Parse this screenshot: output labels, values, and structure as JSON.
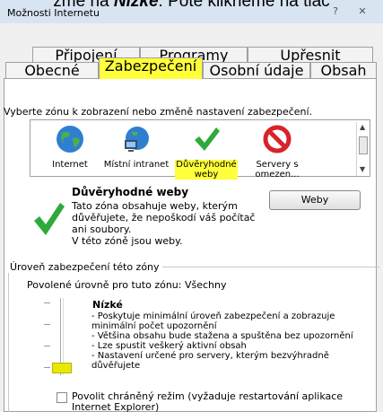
{
  "caption_parts": {
    "pre": "zme na ",
    "bold": "Nízké",
    "post": ". Poté klikneme na tlač"
  },
  "window": {
    "title": "Možnosti Internetu",
    "help_glyph": "?",
    "close_glyph": "✕"
  },
  "tabs_top": [
    "Připojení",
    "Programy",
    "Upřesnit"
  ],
  "tabs_bottom": [
    "Obecné",
    "Zabezpečení",
    "Osobní údaje",
    "Obsah"
  ],
  "zones": {
    "instruction": "Vyberte zónu k zobrazení nebo změně nastavení zabezpečení.",
    "items": [
      {
        "label": "Internet",
        "icon": "globe-icon"
      },
      {
        "label": "Místní intranet",
        "icon": "intranet-icon"
      },
      {
        "label": "Důvěryhodné weby",
        "icon": "checkmark-icon"
      },
      {
        "label": "Servery s omezen...",
        "icon": "restricted-icon"
      }
    ]
  },
  "selected_zone": {
    "name": "Důvěryhodné weby",
    "description_1": "Tato zóna obsahuje weby, kterým důvěřujete, že nepoškodí váš počítač ani soubory.",
    "description_2": "V této zóně jsou weby.",
    "sites_button": "Weby"
  },
  "security_level": {
    "legend": "Úroveň zabezpečení této zóny",
    "allowed": "Povolené úrovně pro tuto zónu: Všechny",
    "level_name": "Nízké",
    "lines": [
      "- Poskytuje minimální úroveň zabezpečení a zobrazuje minimální počet upozornění",
      "- Většina obsahu bude stažena a spuštěna bez upozornění",
      "- Lze spustit veškerý aktivní obsah",
      "- Nastavení určené pro servery, kterým bezvýhradně důvěřujete"
    ],
    "slider_position": "lowest"
  },
  "protected_mode": {
    "label": "Povolit chráněný režim (vyžaduje restartování aplikace Internet Explorer)",
    "checked": false
  },
  "colors": {
    "highlight": "#ffff3a",
    "check_green": "#2eaa3a",
    "restricted_red": "#d8232a"
  }
}
